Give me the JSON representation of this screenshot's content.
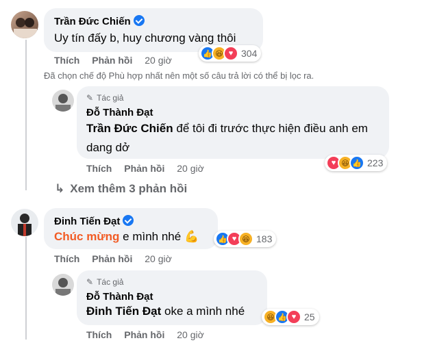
{
  "colors": {
    "orange_tag": "#f25b24",
    "blue": "#1877f2",
    "gray": "#65676b",
    "bubble": "#f0f2f5"
  },
  "comments": [
    {
      "name": "Trần Đức Chiến",
      "text": "Uy tín đấy b, huy chương vàng thôi",
      "like": "Thích",
      "reply": "Phản hồi",
      "time": "20 giờ",
      "reactions": [
        "like-icon",
        "haha-icon",
        "love-icon"
      ],
      "count": "304"
    },
    {
      "author_label": "Tác giả",
      "name": "Đỗ Thành Đạt",
      "tag": "Trần Đức Chiến",
      "text": "để tôi đi trước thực hiện điều anh em dang dở",
      "like": "Thích",
      "reply": "Phản hồi",
      "time": "20 giờ",
      "reactions": [
        "love-icon",
        "haha-icon",
        "like-icon"
      ],
      "count": "223"
    },
    {
      "name": "Đinh Tiến Đạt",
      "tag": "Chúc mừng",
      "text": "e mình nhé",
      "emoji": "💪",
      "like": "Thích",
      "reply": "Phản hồi",
      "time": "20 giờ",
      "reactions": [
        "like-icon",
        "love-icon",
        "haha-icon"
      ],
      "count": "183"
    },
    {
      "author_label": "Tác giả",
      "name": "Đỗ Thành Đạt",
      "tag": "Đinh Tiến Đạt",
      "text": "oke a mình nhé",
      "like": "Thích",
      "reply": "Phản hồi",
      "time": "20 giờ",
      "reactions": [
        "haha-icon",
        "like-icon",
        "love-icon"
      ],
      "count": "25"
    }
  ],
  "filter_note": "Đã chọn chế độ Phù hợp nhất nên một số câu trả lời có thể bị lọc ra.",
  "view_more": "Xem thêm 3 phản hồi"
}
